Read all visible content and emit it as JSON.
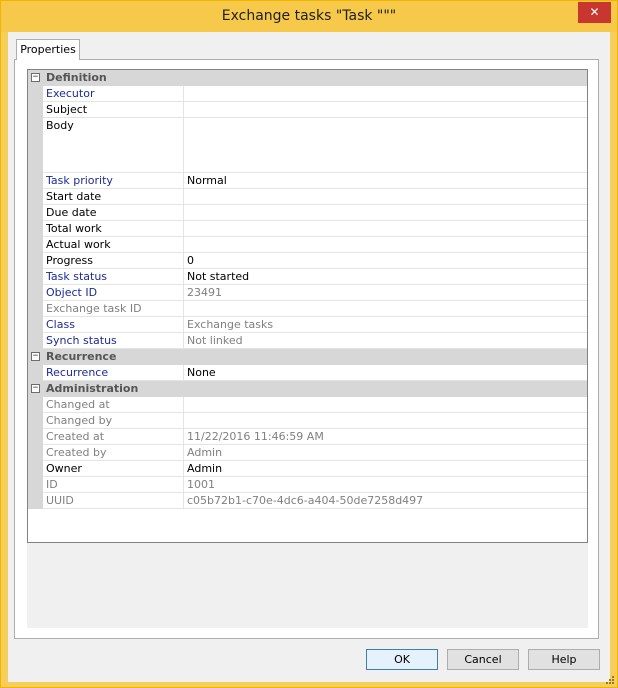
{
  "window": {
    "title": "Exchange tasks \"Task \"\"\"",
    "close_glyph": "✕"
  },
  "tabs": [
    {
      "label": "Properties"
    }
  ],
  "sections": {
    "definition": "Definition",
    "recurrence": "Recurrence",
    "administration": "Administration"
  },
  "props": {
    "executor": {
      "name": "Executor",
      "value": ""
    },
    "subject": {
      "name": "Subject",
      "value": ""
    },
    "body": {
      "name": "Body",
      "value": ""
    },
    "task_priority": {
      "name": "Task priority",
      "value": "Normal"
    },
    "start_date": {
      "name": "Start date",
      "value": ""
    },
    "due_date": {
      "name": "Due date",
      "value": ""
    },
    "total_work": {
      "name": "Total work",
      "value": ""
    },
    "actual_work": {
      "name": "Actual work",
      "value": ""
    },
    "progress": {
      "name": "Progress",
      "value": "0"
    },
    "task_status": {
      "name": "Task status",
      "value": "Not started"
    },
    "object_id": {
      "name": "Object ID",
      "value": "23491"
    },
    "exchange_task_id": {
      "name": "Exchange task ID",
      "value": ""
    },
    "class": {
      "name": "Class",
      "value": "Exchange tasks"
    },
    "synch_status": {
      "name": "Synch status",
      "value": "Not linked"
    },
    "recurrence": {
      "name": "Recurrence",
      "value": "None"
    },
    "changed_at": {
      "name": "Changed at",
      "value": ""
    },
    "changed_by": {
      "name": "Changed by",
      "value": ""
    },
    "created_at": {
      "name": "Created at",
      "value": "11/22/2016 11:46:59 AM"
    },
    "created_by": {
      "name": "Created by",
      "value": "Admin"
    },
    "owner": {
      "name": "Owner",
      "value": "Admin"
    },
    "id": {
      "name": "ID",
      "value": "1001"
    },
    "uuid": {
      "name": "UUID",
      "value": "c05b72b1-c70e-4dc6-a404-50de7258d497"
    }
  },
  "buttons": {
    "ok": "OK",
    "cancel": "Cancel",
    "help": "Help"
  },
  "colors": {
    "title_bar": "#f7c94a",
    "close": "#c7372f",
    "link_blue": "#1a2b9a",
    "readonly_gray": "#808080"
  }
}
